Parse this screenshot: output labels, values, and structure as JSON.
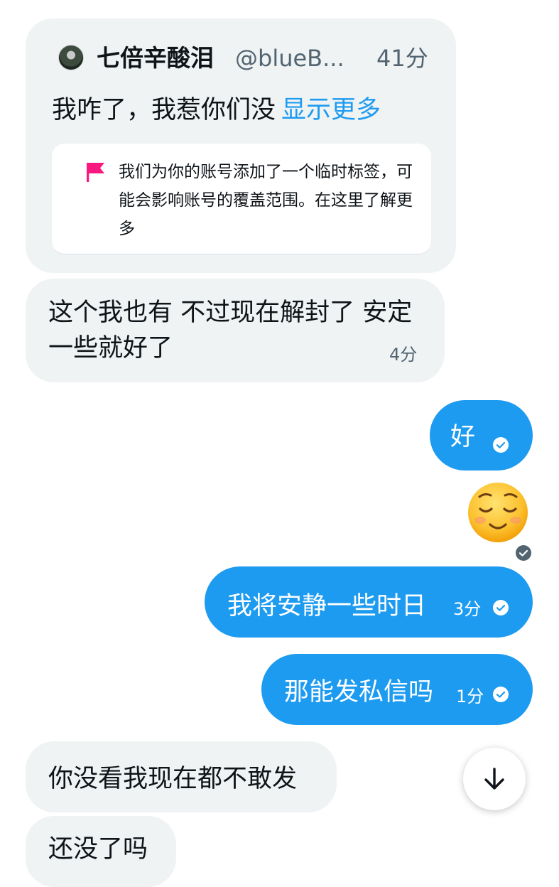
{
  "quoted_tweet": {
    "author_name": "七倍辛酸泪",
    "author_handle": "@blueB...",
    "time": "41分",
    "text": "我咋了，我惹你们没",
    "show_more_label": "显示更多",
    "notice_text": "我们为你的账号添加了一个临时标签，可能会影响账号的覆盖范围。在这里了解更多"
  },
  "messages": [
    {
      "direction": "incoming",
      "text": "这个我也有 不过现在解封了 安定一些就好了",
      "time": "4分"
    },
    {
      "direction": "outgoing",
      "text": "好",
      "time": ""
    },
    {
      "direction": "outgoing",
      "text": "😌",
      "time": ""
    },
    {
      "direction": "outgoing",
      "text": "我将安静一些时日",
      "time": "3分"
    },
    {
      "direction": "outgoing",
      "text": "那能发私信吗",
      "time": "1分"
    },
    {
      "direction": "incoming",
      "text": "你没看我现在都不敢发",
      "time": ""
    },
    {
      "direction": "incoming",
      "text": "还没了吗",
      "time": ""
    }
  ],
  "colors": {
    "accent": "#1d9bf0",
    "incoming_bubble": "#eff3f4",
    "flag": "#f91880",
    "text_primary": "#0f1419",
    "text_secondary": "#536471"
  },
  "icons": {
    "flag": "flag-icon",
    "read_receipt": "check-circle-icon",
    "scroll_down": "arrow-down-icon"
  }
}
